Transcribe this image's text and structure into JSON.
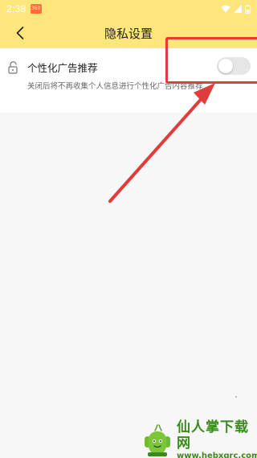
{
  "status_bar": {
    "time": "2:38",
    "app_badge": "360"
  },
  "app_bar": {
    "title": "隐私设置"
  },
  "settings": {
    "personalized_ads": {
      "title": "个性化广告推荐",
      "description": "关闭后将不再收集个人信息进行个性化广告内容推荐",
      "enabled": false
    }
  },
  "watermark": {
    "name": "仙人掌下载网",
    "url": "www.hebxqrc.com"
  },
  "colors": {
    "header": "#fde77d",
    "annotation": "#e23b3b",
    "toggle_off": "#e6e6e6",
    "watermark": "#3a8a1e"
  },
  "icons": {
    "back": "chevron-left-icon",
    "setting": "unlock-icon"
  }
}
